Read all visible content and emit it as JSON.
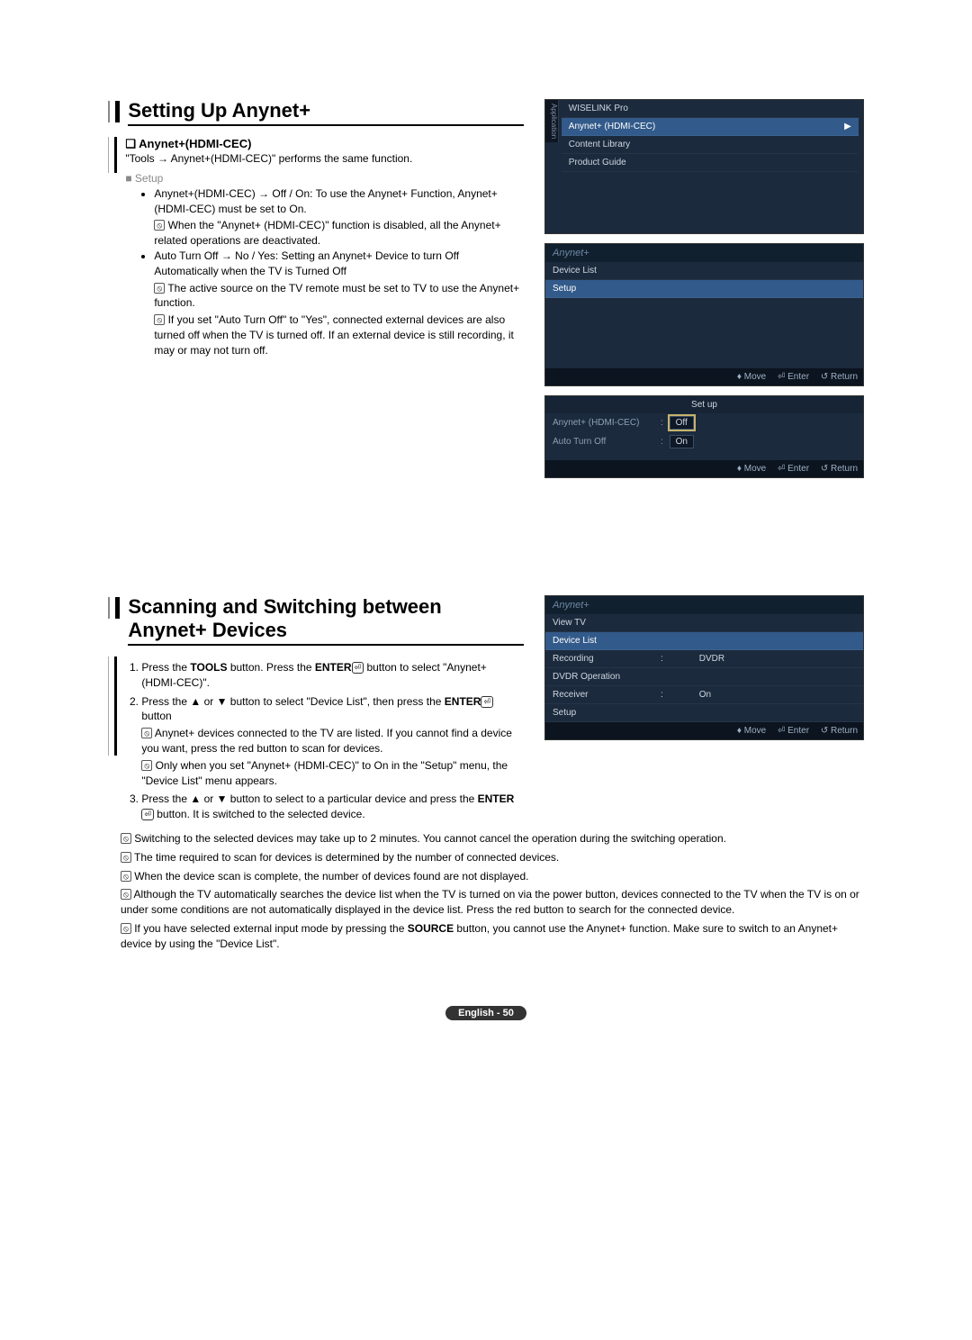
{
  "section1": {
    "title": "Setting Up Anynet+",
    "subheading_prefix": "❑",
    "subheading": "Anynet+(HDMI-CEC)",
    "intro": "\"Tools → Anynet+(HDMI-CEC)\" performs the same function.",
    "setup_label": "■  Setup",
    "b1": "Anynet+(HDMI-CEC) → Off / On: To use the Anynet+ Function, Anynet+ (HDMI-CEC) must be set to On.",
    "n1": "When the \"Anynet+ (HDMI-CEC)\" function is disabled, all the Anynet+ related operations are deactivated.",
    "b2": "Auto Turn Off → No / Yes: Setting an Anynet+ Device to turn Off Automatically when the TV is Turned Off",
    "n2": "The active source on the TV remote must be set to TV to use the Anynet+ function.",
    "n3": "If you set \"Auto Turn Off\" to \"Yes\", connected external devices are also turned off when the TV is turned off. If an external device is still recording, it may or may not turn off."
  },
  "panelA": {
    "sidetab": "Application",
    "items": [
      "WISELINK Pro",
      "Anynet+ (HDMI-CEC)",
      "Content Library",
      "Product Guide"
    ],
    "sel_index": 1
  },
  "panelB": {
    "brand": "Anynet+",
    "items": [
      "Device List",
      "Setup"
    ],
    "sel_index": 1,
    "foot_move": "♦ Move",
    "foot_enter": "⏎ Enter",
    "foot_return": "↺ Return"
  },
  "panelC": {
    "title": "Set up",
    "row1_k": "Anynet+ (HDMI-CEC)",
    "row1_v": "Off",
    "row2_k": "Auto Turn Off",
    "row2_v": "On",
    "foot_move": "♦ Move",
    "foot_enter": "⏎ Enter",
    "foot_return": "↺ Return"
  },
  "section2": {
    "title": "Scanning and Switching between Anynet+ Devices",
    "s1_a": "Press the ",
    "s1_b": "TOOLS",
    "s1_c": " button. Press the ",
    "s1_d": "ENTER",
    "s1_e": " button to select \"Anynet+ (HDMI-CEC)\".",
    "s2_a": "Press the ▲ or ▼ button to select \"Device List\", then press the ",
    "s2_b": "ENTER",
    "s2_c": " button",
    "n1": "Anynet+ devices connected to the TV are listed. If you cannot find a device you want, press the red button to scan for devices.",
    "n2": "Only when you set \"Anynet+ (HDMI-CEC)\" to On in the \"Setup\" menu, the \"Device List\" menu appears.",
    "s3_a": "Press the ▲ or ▼ button to select to a particular device and press the ",
    "s3_b": "ENTER",
    "s3_c": " button. It is switched to the selected device.",
    "bn1": "Switching to the selected devices may take up to 2 minutes. You cannot cancel the operation during the switching operation.",
    "bn2": "The time required to scan for devices is determined by the number of connected devices.",
    "bn3": "When the device scan is complete, the number of devices found are not displayed.",
    "bn4": "Although the TV automatically searches the device list when the TV is turned on via the power button, devices connected to the TV when the TV is on or under some conditions are not automatically displayed in the device list. Press the red button to search for the connected device.",
    "bn5_a": "If you have selected external input mode by pressing the ",
    "bn5_b": "SOURCE",
    "bn5_c": " button, you cannot use the Anynet+ function. Make sure to switch to an Anynet+ device by using the \"Device List\"."
  },
  "panelD": {
    "brand": "Anynet+",
    "rows": [
      {
        "label": "View TV",
        "val": ""
      },
      {
        "label": "Device List",
        "val": "",
        "sel": true
      },
      {
        "label": "Recording",
        "colon": ":",
        "val": "DVDR"
      },
      {
        "label": "DVDR Operation",
        "val": ""
      },
      {
        "label": "Receiver",
        "colon": ":",
        "val": "On"
      },
      {
        "label": "Setup",
        "val": ""
      }
    ],
    "foot_move": "♦ Move",
    "foot_enter": "⏎ Enter",
    "foot_return": "↺ Return"
  },
  "footer": {
    "label": "English - 50"
  },
  "glyph": {
    "note": "⦸",
    "enter": "⏎"
  }
}
